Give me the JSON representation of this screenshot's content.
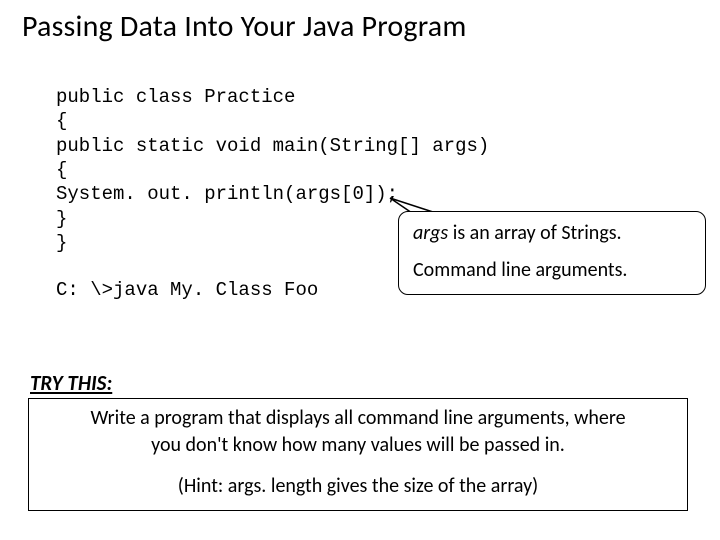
{
  "title": "Passing Data Into Your Java Program",
  "code": "public class Practice\n{\npublic static void main(String[] args)\n{\nSystem. out. println(args[0]);\n}\n}",
  "cmd": "C: \\>java My. Class Foo",
  "callout": {
    "italic_word": "args",
    "line1_rest": " is an array of Strings.",
    "line2": "Command line arguments."
  },
  "try": {
    "label": "TRY THIS:",
    "body1": "Write a program that displays all command line arguments, where",
    "body2": "you don't know how many values will be passed in.",
    "hint": "(Hint: args. length gives the size of the array)"
  }
}
